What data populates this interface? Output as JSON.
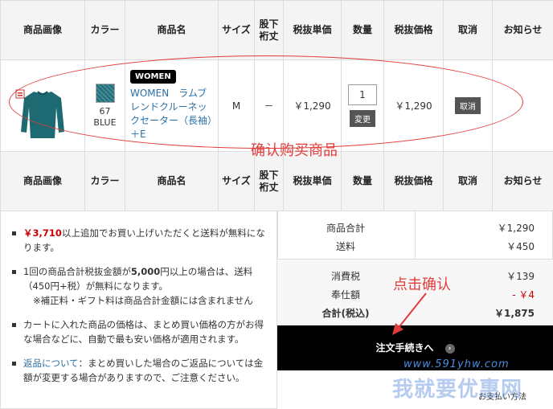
{
  "headers": [
    "商品画像",
    "カラー",
    "商品名",
    "サイズ",
    "股下\n裄丈",
    "税抜単価",
    "数量",
    "税抜価格",
    "取消",
    "お知らせ"
  ],
  "item": {
    "color_code": "67",
    "color_name": "BLUE",
    "badge": "WOMEN",
    "name": "WOMEN　ラムブレンドクルーネックセーター（長袖）＋E",
    "size": "M",
    "inseam": "－",
    "unit_price": "￥1,290",
    "quantity": "1",
    "change_label": "変更",
    "price": "￥1,290",
    "cancel_label": "取消",
    "swatch_color": "#1f6f7a"
  },
  "notes": {
    "n1_amount": "￥3,710",
    "n1_text": "以上追加でお買い上げいただくと送料が無料になります。",
    "n2_a": "1回の商品合計税抜金額が",
    "n2_b": "5,000",
    "n2_c": "円以上の場合は、送料（450円+税）が無料になります。",
    "n2_sub": "※補正料・ギフト料は商品合計金額には含まれません",
    "n3": "カートに入れた商品の価格は、まとめ買い価格の方がお得な場合などに、自動で最も安い価格が適用されます。",
    "n4_link": "返品について",
    "n4_text": "：まとめ買いした場合のご返品については金額が変更する場合がありますので、ご注意ください。"
  },
  "summary": {
    "subtotal_label": "商品合計",
    "subtotal": "￥1,290",
    "shipping_label": "送料",
    "shipping": "￥450",
    "tax_label": "消費税",
    "tax": "￥139",
    "discount_label": "奉仕額",
    "discount": "- ￥4",
    "total_label": "合計(税込)",
    "total": "￥1,875",
    "checkout_label": "注文手続きへ",
    "pay_methods": "お支払い方法"
  },
  "annotations": {
    "confirm_items": "确认购买商品",
    "click_confirm": "点击确认"
  },
  "watermark": {
    "url": "www.591yhw.com",
    "name": "我就要优惠网"
  },
  "colors": {
    "annotation": "#e23b3b",
    "link": "#2a6fa8",
    "price_red": "#cc0000"
  }
}
